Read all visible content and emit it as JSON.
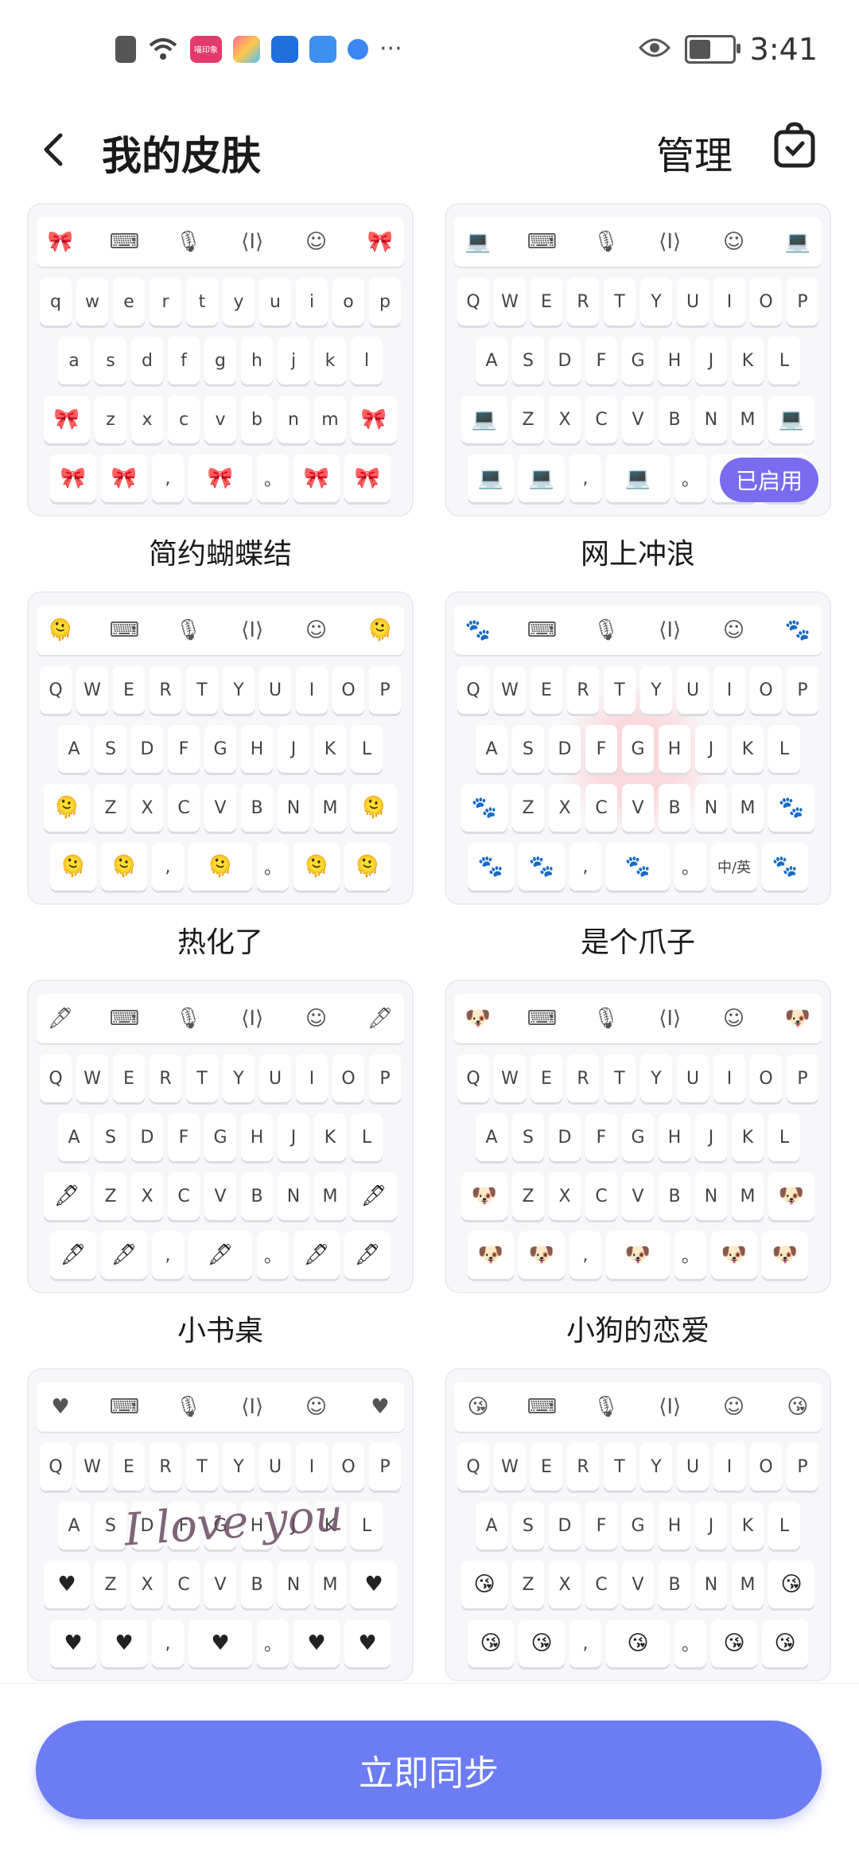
{
  "status_bar": {
    "time": "3:41",
    "badge_text": "喵印象",
    "icons": [
      "alert-icon",
      "wifi-icon",
      "app-icon",
      "app-icon",
      "bulb-icon",
      "cloud-icon",
      "globe-icon",
      "more-icon"
    ],
    "right_icons": [
      "eye-icon",
      "battery-icon"
    ]
  },
  "header": {
    "title": "我的皮肤",
    "manage_label": "管理"
  },
  "skins": [
    {
      "name": "简约蝴蝶结",
      "case": "lower",
      "deco": "🎀",
      "active": false
    },
    {
      "name": "网上冲浪",
      "case": "upper",
      "deco": "💻",
      "active": true,
      "badge": "已启用"
    },
    {
      "name": "热化了",
      "case": "upper",
      "deco": "🫠",
      "active": false
    },
    {
      "name": "是个爪子",
      "case": "upper",
      "deco": "🐾",
      "active": false,
      "lang_key": "中/英"
    },
    {
      "name": "小书桌",
      "case": "upper",
      "deco": "🖋",
      "active": false
    },
    {
      "name": "小狗的恋爱",
      "case": "upper",
      "deco": "🐶",
      "active": false
    },
    {
      "name": "",
      "case": "upper",
      "deco": "♥",
      "active": false,
      "overlay_text": "I love you"
    },
    {
      "name": "",
      "case": "upper",
      "deco": "😘",
      "active": false
    }
  ],
  "keyboard": {
    "row1": [
      "Q",
      "W",
      "E",
      "R",
      "T",
      "Y",
      "U",
      "I",
      "O",
      "P"
    ],
    "row2": [
      "A",
      "S",
      "D",
      "F",
      "G",
      "H",
      "J",
      "K",
      "L"
    ],
    "row3": [
      "Z",
      "X",
      "C",
      "V",
      "B",
      "N",
      "M"
    ],
    "comma": ",",
    "period": "。"
  },
  "footer": {
    "sync_label": "立即同步"
  },
  "colors": {
    "accent": "#6c7cf3",
    "badge": "#7a6cf0"
  }
}
